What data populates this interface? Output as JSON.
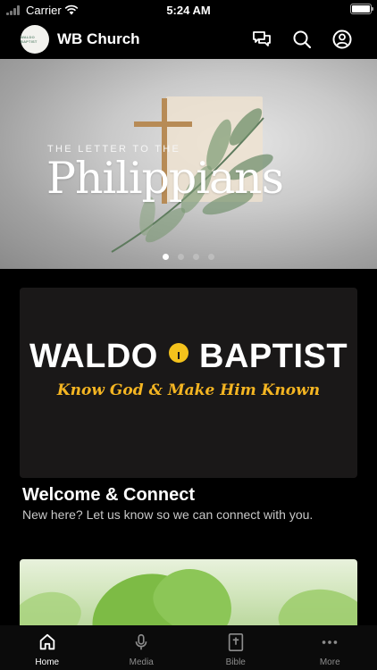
{
  "status_bar": {
    "carrier": "Carrier",
    "time": "5:24 AM",
    "battery_level": 1.0
  },
  "header": {
    "title": "WB Church",
    "avatar_text": "WALDO BAPTIST",
    "icons": [
      "chat-bubbles-icon",
      "search-icon",
      "profile-icon"
    ]
  },
  "hero": {
    "kicker": "THE LETTER TO THE",
    "title": "Philippians",
    "slide_count": 4,
    "active_slide": 1
  },
  "welcome_card": {
    "brand_left": "WALDO",
    "brand_right": "BAPTIST",
    "tagline": "Know God & Make Him Known",
    "title": "Welcome & Connect",
    "subtitle": "New here?  Let us know so we can connect with you."
  },
  "tab_bar": {
    "tabs": [
      {
        "label": "Home",
        "icon": "home-icon",
        "active": true
      },
      {
        "label": "Media",
        "icon": "microphone-icon",
        "active": false
      },
      {
        "label": "Bible",
        "icon": "bible-icon",
        "active": false
      },
      {
        "label": "More",
        "icon": "more-dots-icon",
        "active": false
      }
    ]
  },
  "colors": {
    "background": "#000000",
    "accent_gold": "#f4b522",
    "tab_inactive": "#8c8c8c"
  }
}
